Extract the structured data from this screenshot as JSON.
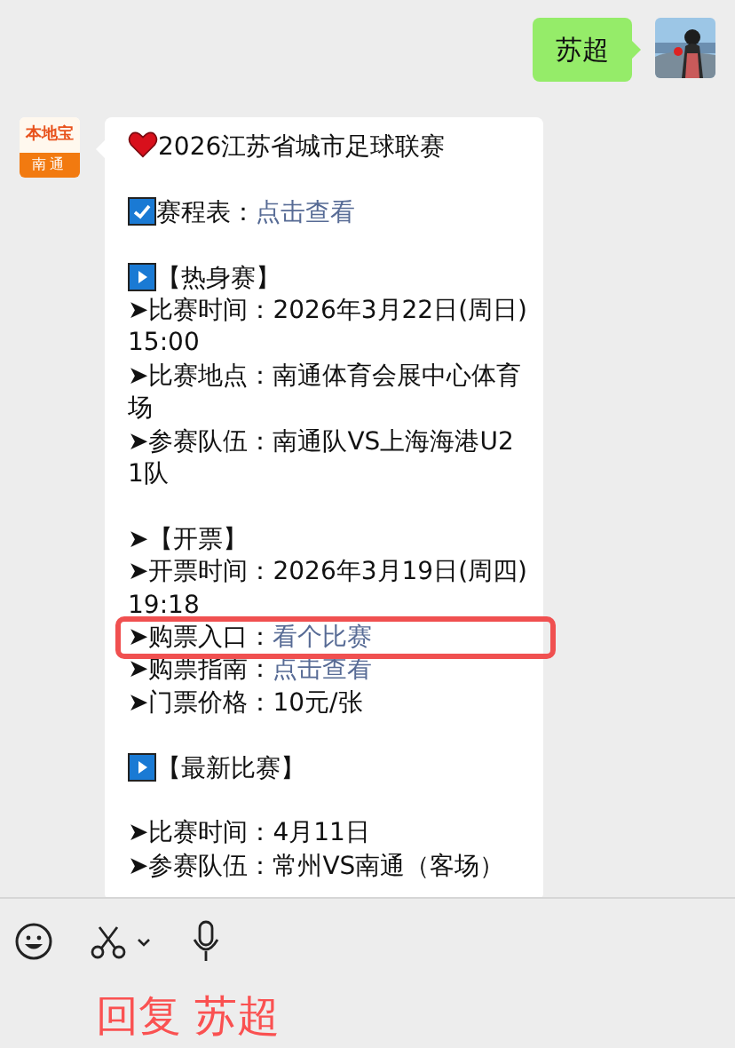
{
  "outgoing": {
    "text": "苏超"
  },
  "incoming": {
    "logo": {
      "top": "本地宝",
      "bottom": "南通"
    },
    "lines": [
      {
        "kind": "heart",
        "text": "2026江苏省城市足球联赛",
        "highlighted": false
      },
      {
        "kind": "blank",
        "highlighted": false
      },
      {
        "kind": "check",
        "text": "赛程表：",
        "link": "点击查看",
        "highlighted": false
      },
      {
        "kind": "blank",
        "highlighted": false
      },
      {
        "kind": "play",
        "text": "【热身赛】",
        "highlighted": false
      },
      {
        "kind": "text",
        "text": "➤比赛时间：2026年3月22日(周日)15:00",
        "highlighted": false
      },
      {
        "kind": "text",
        "text": "➤比赛地点：南通体育会展中心体育场",
        "highlighted": false
      },
      {
        "kind": "text",
        "text": "➤参赛队伍：南通队VS上海海港U21队",
        "highlighted": false
      },
      {
        "kind": "blank",
        "highlighted": false
      },
      {
        "kind": "text",
        "text": "➤【开票】",
        "highlighted": false
      },
      {
        "kind": "text",
        "text": "➤开票时间：2026年3月19日(周四)19:18",
        "highlighted": false
      },
      {
        "kind": "text",
        "text": "➤购票入口：",
        "link": "看个比赛",
        "highlighted": true
      },
      {
        "kind": "text",
        "text": "➤购票指南：",
        "link": "点击查看",
        "highlighted": false
      },
      {
        "kind": "text",
        "text": "➤门票价格：10元/张",
        "highlighted": false
      },
      {
        "kind": "blank",
        "highlighted": false
      },
      {
        "kind": "play",
        "text": "【最新比赛】",
        "highlighted": false
      },
      {
        "kind": "blank",
        "highlighted": false
      },
      {
        "kind": "text",
        "text": "➤比赛时间：4月11日",
        "highlighted": false
      },
      {
        "kind": "text",
        "text": "➤参赛队伍：常州VS南通（客场）",
        "highlighted": false
      }
    ]
  },
  "reply": {
    "text": "回复 苏超"
  }
}
